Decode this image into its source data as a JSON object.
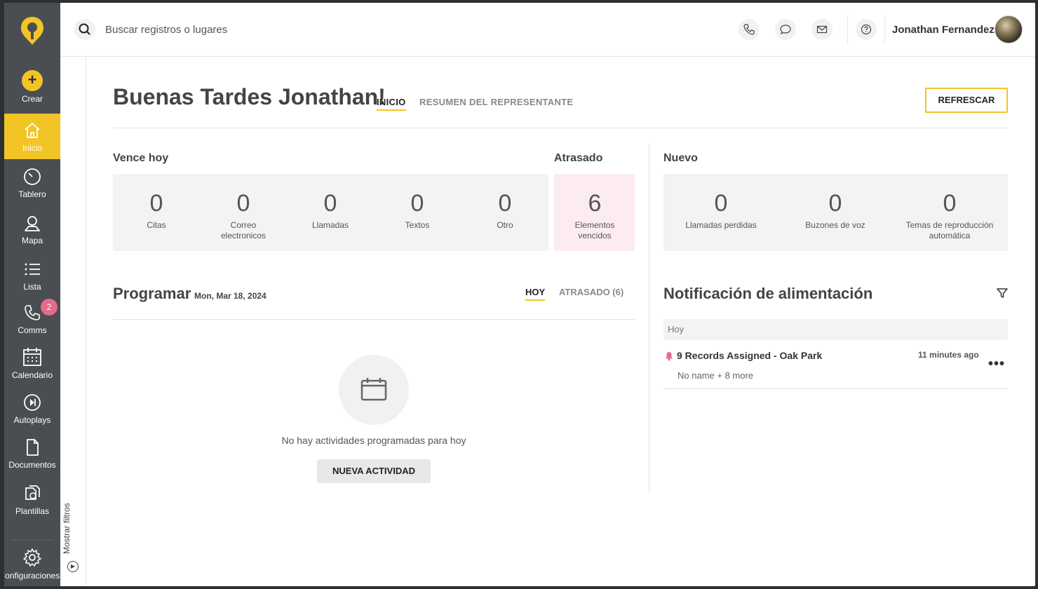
{
  "sidebar": {
    "create_label": "Crear",
    "items": [
      {
        "label": "Inicio"
      },
      {
        "label": "Tablero"
      },
      {
        "label": "Mapa"
      },
      {
        "label": "Lista"
      },
      {
        "label": "Comms",
        "badge": "2"
      },
      {
        "label": "Calendario"
      },
      {
        "label": "Autoplays"
      },
      {
        "label": "Documentos"
      },
      {
        "label": "Plantillas"
      }
    ],
    "settings_label": "Configuraciones"
  },
  "filters": {
    "label": "Mostrar filtros"
  },
  "topbar": {
    "search_placeholder": "Buscar registros o lugares",
    "user_name": "Jonathan Fernandez"
  },
  "header": {
    "greeting": "Buenas Tardes Jonathan!",
    "tabs": [
      {
        "label": "INICIO",
        "active": true
      },
      {
        "label": "RESUMEN DEL REPRESENTANTE",
        "active": false
      }
    ],
    "refresh_label": "REFRESCAR"
  },
  "due_today": {
    "title": "Vence hoy",
    "stats": [
      {
        "value": "0",
        "label": "Citas"
      },
      {
        "value": "0",
        "label": "Correo electronicos"
      },
      {
        "value": "0",
        "label": "Llamadas"
      },
      {
        "value": "0",
        "label": "Textos"
      },
      {
        "value": "0",
        "label": "Otro"
      }
    ]
  },
  "overdue": {
    "title": "Atrasado",
    "value": "6",
    "label": "Elementos vencidos"
  },
  "new_section": {
    "title": "Nuevo",
    "stats": [
      {
        "value": "0",
        "label": "Llamadas perdidas"
      },
      {
        "value": "0",
        "label": "Buzones de voz"
      },
      {
        "value": "0",
        "label": "Temas de reproducción automática"
      }
    ]
  },
  "schedule": {
    "title": "Programar",
    "date": "Mon, Mar 18, 2024",
    "tabs": [
      {
        "label": "HOY",
        "active": true
      },
      {
        "label": "ATRASADO (6)",
        "active": false
      }
    ],
    "empty_text": "No hay actividades programadas para hoy",
    "new_activity_label": "NUEVA ACTIVIDAD"
  },
  "feed": {
    "title": "Notificación de alimentación",
    "group_label": "Hoy",
    "items": [
      {
        "title": "9 Records Assigned - Oak Park",
        "time": "11 minutes ago",
        "subtitle": "No name + 8 more"
      }
    ]
  },
  "colors": {
    "accent": "#f2c426",
    "sidebar": "#4a4d52",
    "badge": "#e66a8a",
    "overdue_bg": "#fdecef"
  }
}
